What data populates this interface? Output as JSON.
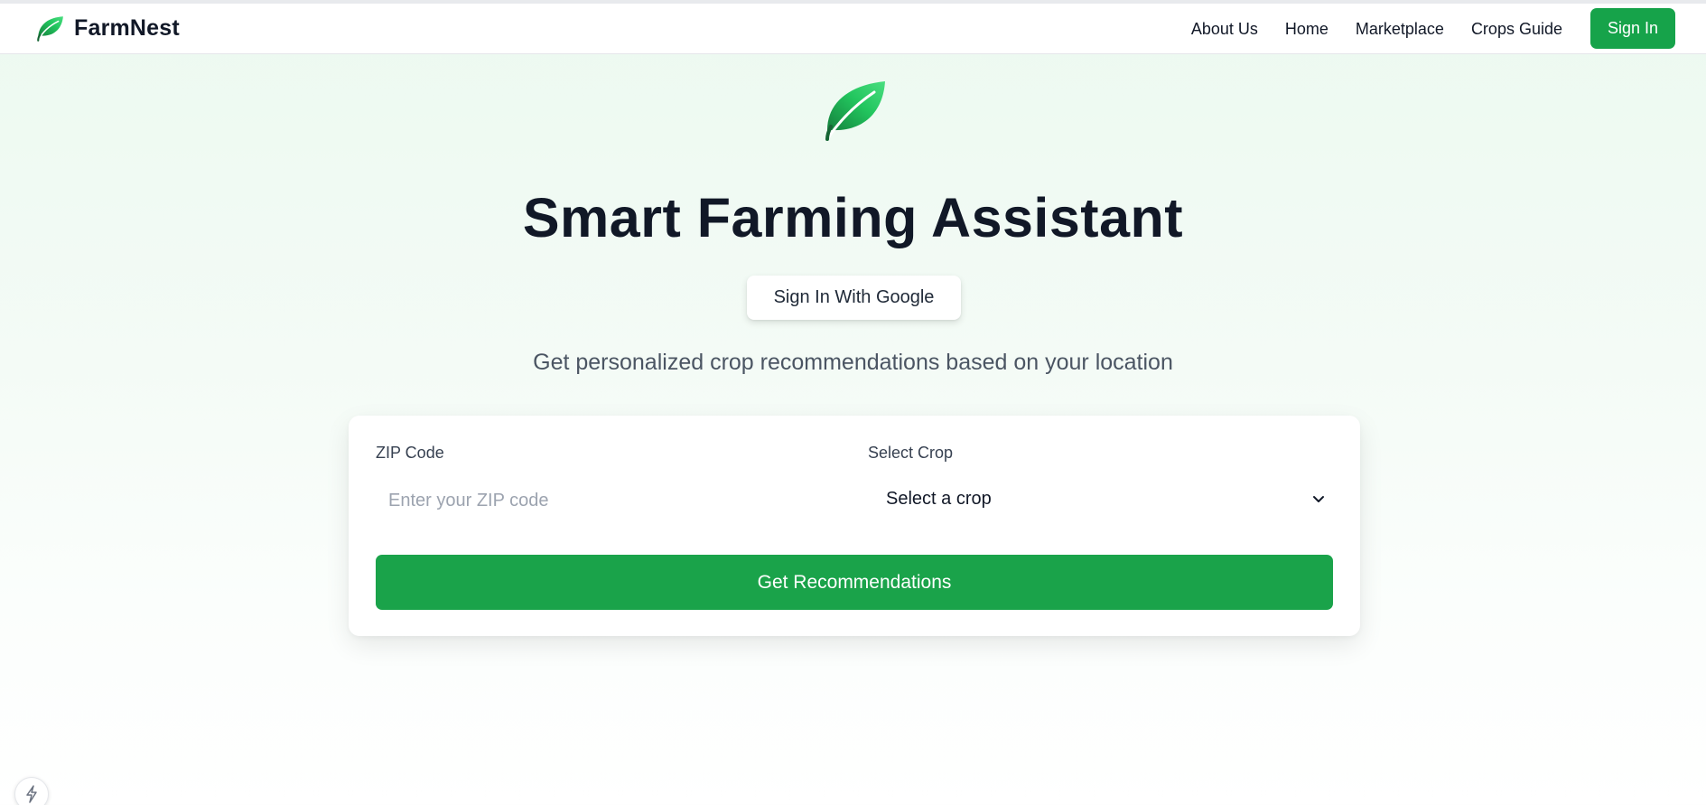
{
  "header": {
    "brand_name": "FarmNest",
    "nav": [
      "About Us",
      "Home",
      "Marketplace",
      "Crops Guide"
    ],
    "sign_in_label": "Sign In"
  },
  "hero": {
    "title": "Smart Farming Assistant",
    "google_button_label": "Sign In With Google",
    "subtitle": "Get personalized crop recommendations based on your location"
  },
  "form": {
    "zip_label": "ZIP Code",
    "zip_placeholder": "Enter your ZIP code",
    "zip_value": "",
    "crop_label": "Select Crop",
    "crop_selected": "Select a crop",
    "submit_label": "Get Recommendations"
  },
  "icons": {
    "brand": "leaf-icon",
    "hero": "leaf-icon",
    "select": "chevron-down-icon",
    "floating": "bolt-icon"
  },
  "colors": {
    "accent": "#16a34a",
    "title": "#111827",
    "subtitle": "#4b5563",
    "background_top": "#ecf9f0"
  }
}
